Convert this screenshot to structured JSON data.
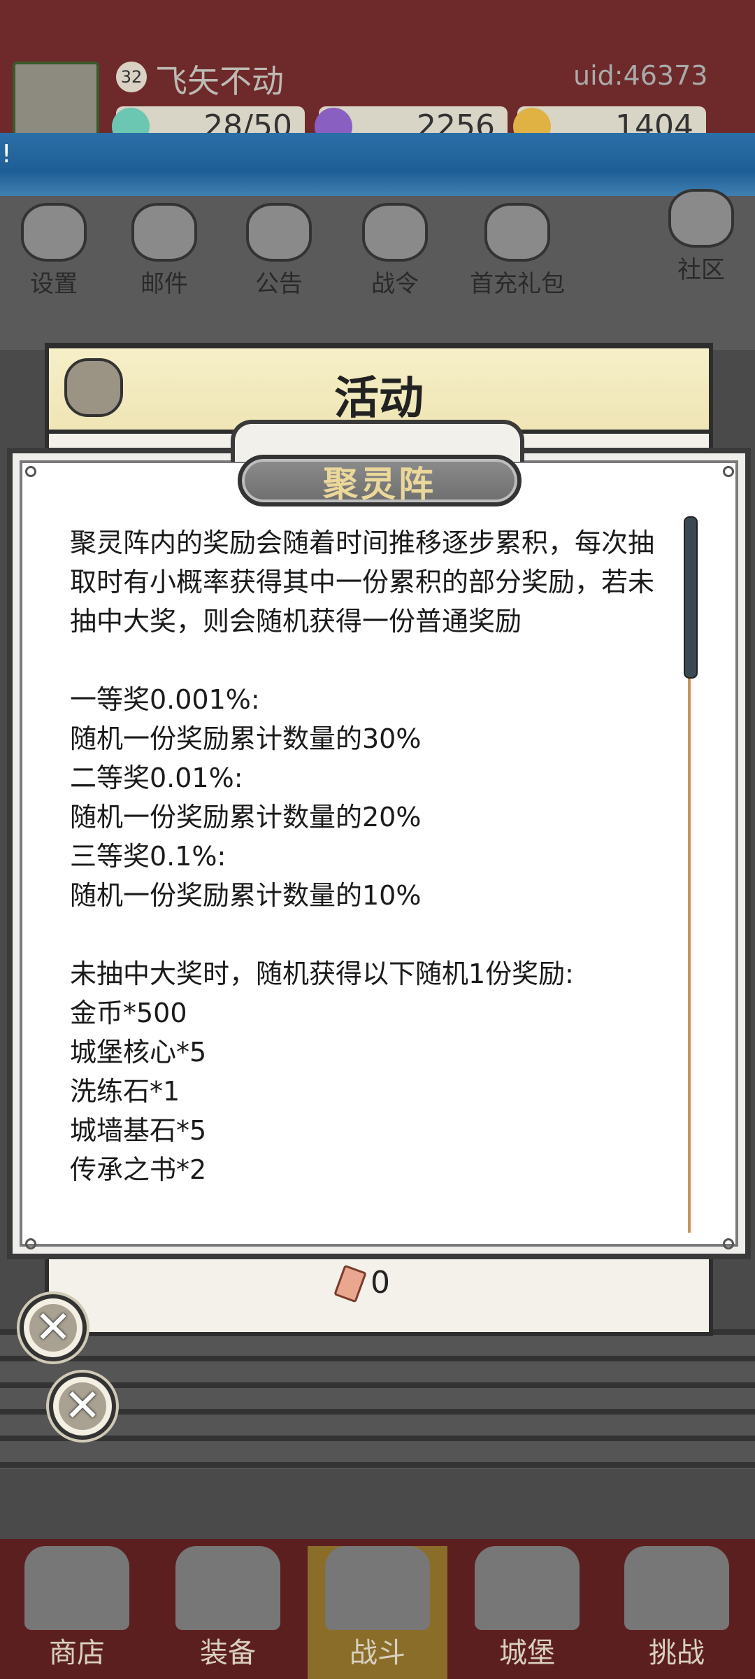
{
  "player": {
    "level": "32",
    "name": "飞矢不动",
    "uid": "uid:46373",
    "energy": "28/50",
    "gems": "2256",
    "gold": "1404"
  },
  "banner": {
    "mark": "!"
  },
  "top_icons": [
    {
      "label": "设置",
      "icon": "gear-icon"
    },
    {
      "label": "邮件",
      "icon": "mail-icon"
    },
    {
      "label": "公告",
      "icon": "scroll-icon"
    },
    {
      "label": "战令",
      "icon": "battle-pass-icon"
    },
    {
      "label": "首充礼包",
      "icon": "gift-bag-icon"
    },
    {
      "label": "社区",
      "icon": "home-icon"
    }
  ],
  "activity": {
    "title": "活动",
    "ticket_count": "0"
  },
  "dialog": {
    "title": "聚灵阵",
    "paragraphs": [
      "聚灵阵内的奖励会随着时间推移逐步累积，每次抽取时有小概率获得其中一份累积的部分奖励，若未抽中大奖，则会随机获得一份普通奖励",
      "",
      "一等奖0.001%:",
      "随机一份奖励累计数量的30%",
      "二等奖0.01%:",
      "随机一份奖励累计数量的20%",
      "三等奖0.1%:",
      "随机一份奖励累计数量的10%",
      "",
      "未抽中大奖时，随机获得以下随机1份奖励:",
      "金币*500",
      "城堡核心*5",
      "洗练石*1",
      "城墙基石*5",
      "传承之书*2"
    ],
    "scroll_position": 0.0
  },
  "bottom_nav": [
    {
      "label": "商店",
      "icon": "shop-icon"
    },
    {
      "label": "装备",
      "icon": "backpack-icon"
    },
    {
      "label": "战斗",
      "icon": "crossed-swords-icon"
    },
    {
      "label": "城堡",
      "icon": "castle-icon"
    },
    {
      "label": "挑战",
      "icon": "shield-icon"
    }
  ],
  "colors": {
    "top_bar": "#6e2a2a",
    "banner_blue": "#1e5e96",
    "dialog_title_text": "#ebd79a",
    "scrollbar_track": "#c8945a"
  }
}
